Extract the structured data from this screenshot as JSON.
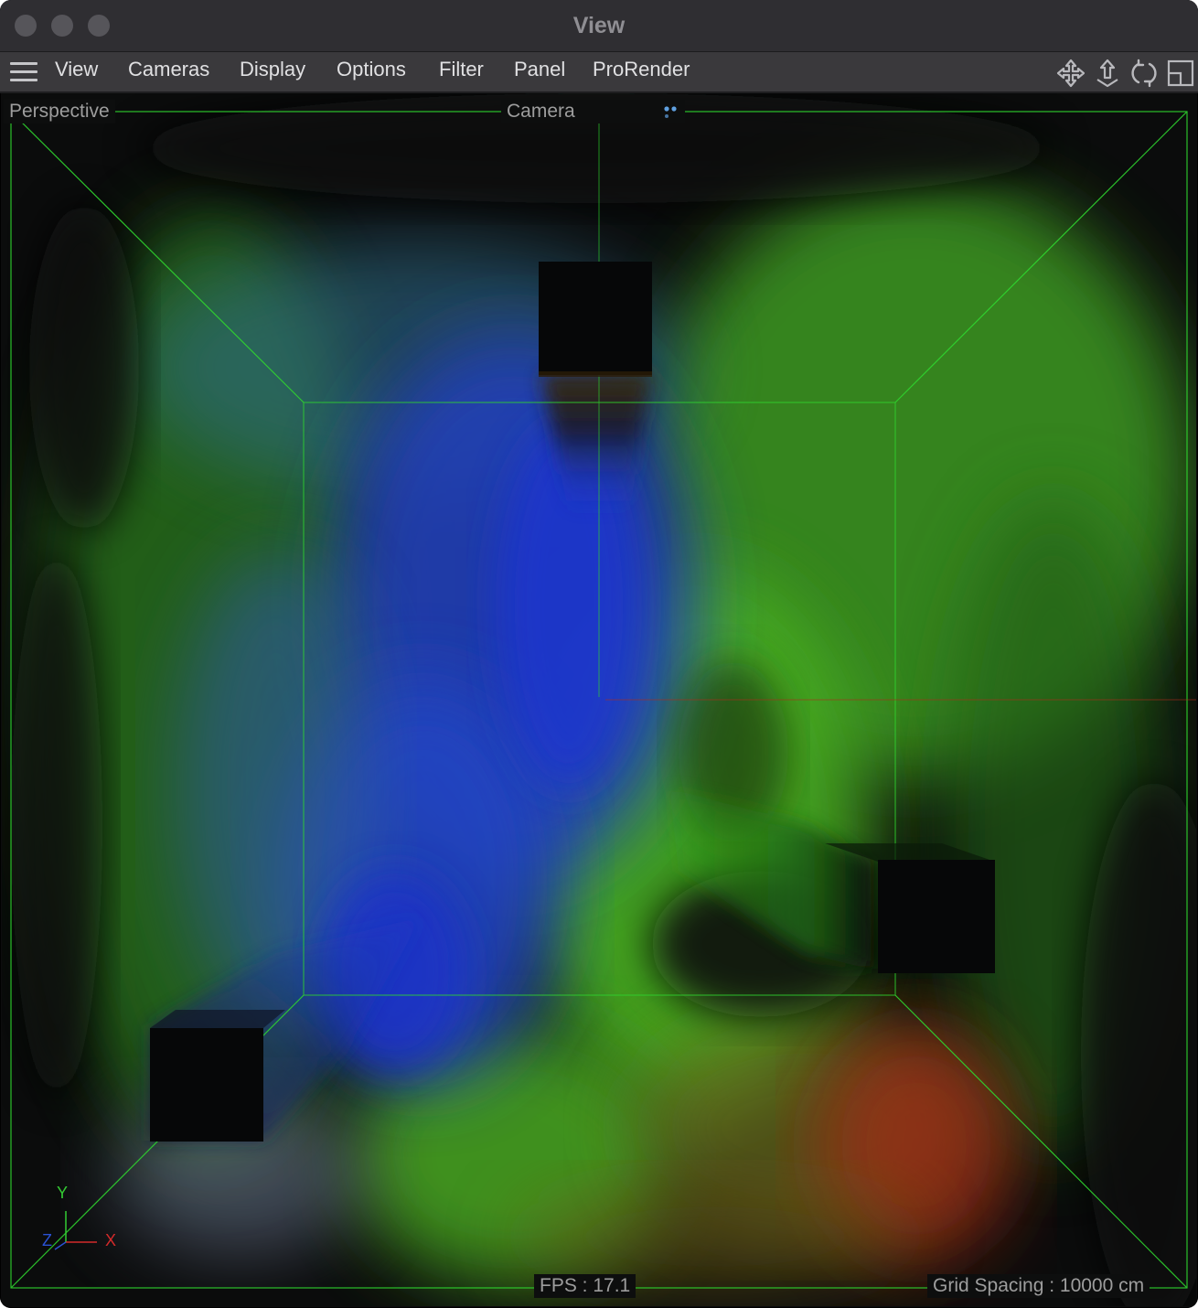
{
  "window": {
    "title": "View"
  },
  "menu": {
    "items": [
      "View",
      "Cameras",
      "Display",
      "Options",
      "Filter",
      "Panel",
      "ProRender"
    ]
  },
  "toolbar_icons": [
    "move-icon",
    "dolly-icon",
    "rotate-icon",
    "maximize-view-icon"
  ],
  "viewport": {
    "projection_label": "Perspective",
    "camera_label": "Camera",
    "fps_text": "FPS : 17.1",
    "grid_text": "Grid Spacing : 10000 cm",
    "axis_labels": {
      "y": "Y",
      "x": "X",
      "z": "Z"
    },
    "colors": {
      "bounding_box": "#2fd52f",
      "axis_x": "#d42a2a",
      "axis_y": "#33cc33",
      "axis_z": "#2a52d4",
      "smoke_blue": "#1f3fd0",
      "smoke_green": "#3fb02a",
      "smoke_red": "#b02a1a"
    }
  }
}
